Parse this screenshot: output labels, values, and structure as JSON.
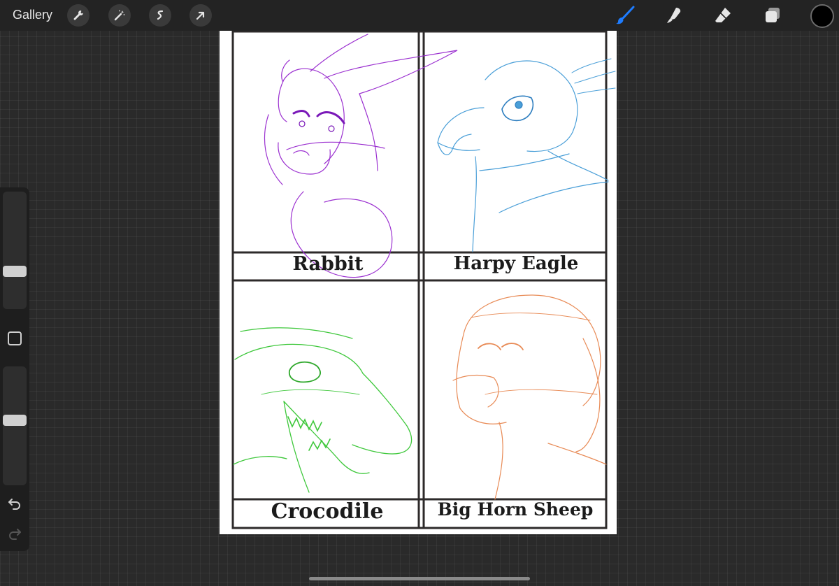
{
  "topbar": {
    "gallery_label": "Gallery",
    "left_tools": [
      "wrench-icon",
      "magic-wand-icon",
      "selection-icon",
      "transform-arrow-icon"
    ],
    "right_tools": [
      "brush-icon",
      "smudge-icon",
      "eraser-icon",
      "layers-icon"
    ],
    "active_tool": "brush",
    "accent_color": "#1e7cff",
    "current_color": "#000000"
  },
  "sidebar": {
    "brush_size": 0.3,
    "opacity": 0.55,
    "icons": [
      "modify-square-icon",
      "undo-icon",
      "redo-icon"
    ]
  },
  "canvas": {
    "panels": [
      {
        "label": "Rabbit",
        "sketch_color": "#9b30d0"
      },
      {
        "label": "Harpy Eagle",
        "sketch_color": "#4a9fd8"
      },
      {
        "label": "Crocodile",
        "sketch_color": "#3fc83c"
      },
      {
        "label": "Big Horn Sheep",
        "sketch_color": "#e88a55"
      }
    ]
  }
}
